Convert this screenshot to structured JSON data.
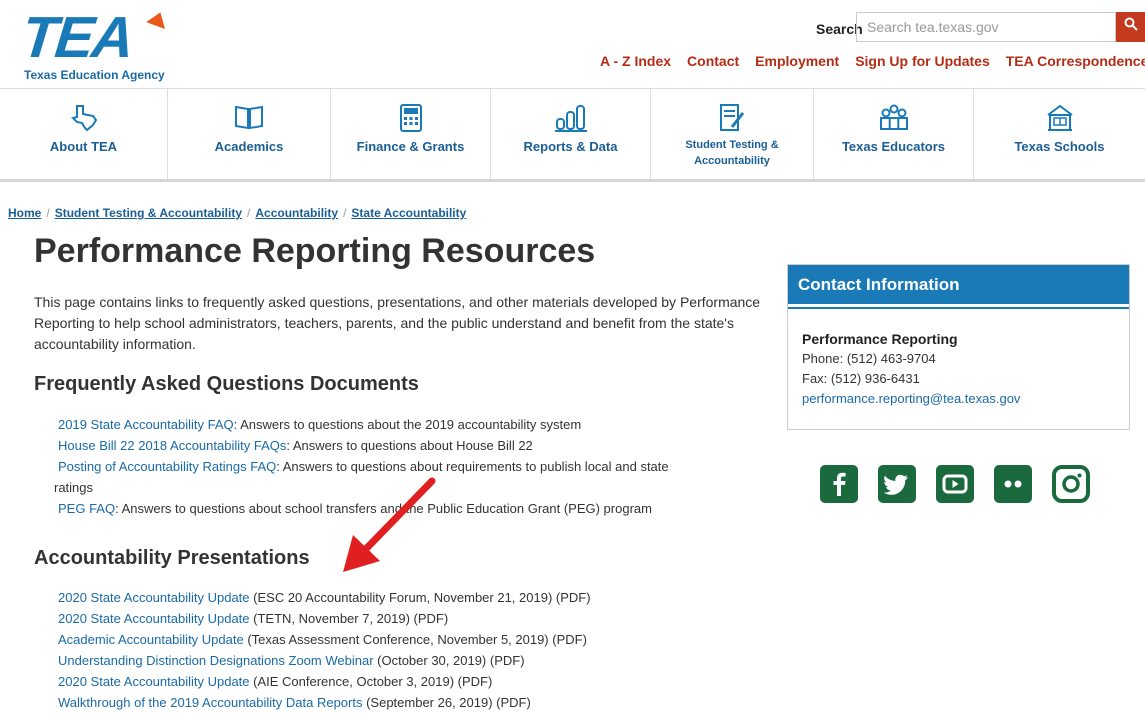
{
  "header": {
    "logo_text": "TEA",
    "logo_sub": "Texas Education Agency",
    "search_label": "Search",
    "search_placeholder": "Search tea.texas.gov",
    "utility_links": [
      "A - Z Index",
      "Contact",
      "Employment",
      "Sign Up for Updates",
      "TEA Correspondence"
    ]
  },
  "nav": [
    {
      "label": "About TEA",
      "icon": "texas-map-icon"
    },
    {
      "label": "Academics",
      "icon": "book-icon"
    },
    {
      "label": "Finance & Grants",
      "icon": "calculator-icon"
    },
    {
      "label": "Reports & Data",
      "icon": "bar-chart-icon"
    },
    {
      "label": "Student Testing & Accountability",
      "icon": "test-paper-icon"
    },
    {
      "label": "Texas Educators",
      "icon": "people-icon"
    },
    {
      "label": "Texas Schools",
      "icon": "school-building-icon"
    }
  ],
  "breadcrumb": [
    "Home",
    "Student Testing & Accountability",
    "Accountability",
    "State Accountability"
  ],
  "main": {
    "title": "Performance Reporting Resources",
    "intro": "This page contains links to frequently asked questions, presentations, and other materials developed by Performance Reporting to help school administrators, teachers, parents, and the public understand and benefit from the state's accountability information.",
    "faq_heading": "Frequently Asked Questions Documents",
    "faq_items": [
      {
        "link": "2019 State Accountability FAQ",
        "text": ": Answers to questions about the 2019 accountability system"
      },
      {
        "link": "House Bill 22 2018 Accountability FAQs",
        "text": ": Answers to questions about House Bill 22"
      },
      {
        "link": "Posting of Accountability Ratings FAQ",
        "text": ":  Answers to questions about requirements to publish local and state"
      },
      {
        "link": "",
        "text": "ratings"
      },
      {
        "link": "PEG FAQ",
        "text": ":  Answers to questions about school transfers and the Public Education Grant (PEG) program"
      }
    ],
    "pres_heading": "Accountability Presentations",
    "pres_items": [
      {
        "link": "2020 State Accountability Update",
        "text": " (ESC 20 Accountability Forum, November 21, 2019) (PDF)"
      },
      {
        "link": "2020 State Accountability Update",
        "text": " (TETN, November 7, 2019) (PDF)"
      },
      {
        "link": "Academic Accountability Update",
        "text": " (Texas Assessment Conference, November 5, 2019) (PDF)"
      },
      {
        "link": "Understanding Distinction Designations Zoom Webinar",
        "text": " (October 30, 2019) (PDF)"
      },
      {
        "link": "2020 State Accountability Update",
        "text": " (AIE Conference, October 3, 2019) (PDF)"
      },
      {
        "link": "Walkthrough of the 2019 Accountability Data Reports",
        "text": " (September 26, 2019) (PDF)"
      }
    ]
  },
  "sidebar": {
    "contact_heading": "Contact Information",
    "org": "Performance Reporting",
    "phone": "Phone: (512) 463-9704",
    "fax": "Fax: (512) 936-6431",
    "email": "performance.reporting@tea.texas.gov",
    "social": [
      "facebook-icon",
      "twitter-icon",
      "youtube-icon",
      "flickr-icon",
      "instagram-icon"
    ]
  },
  "colors": {
    "brand_blue": "#1a7ab8",
    "link_blue": "#1a6aa8",
    "utility_red": "#b42c14",
    "social_green": "#1a6a3e",
    "annotation_arrow": "#e02020"
  }
}
